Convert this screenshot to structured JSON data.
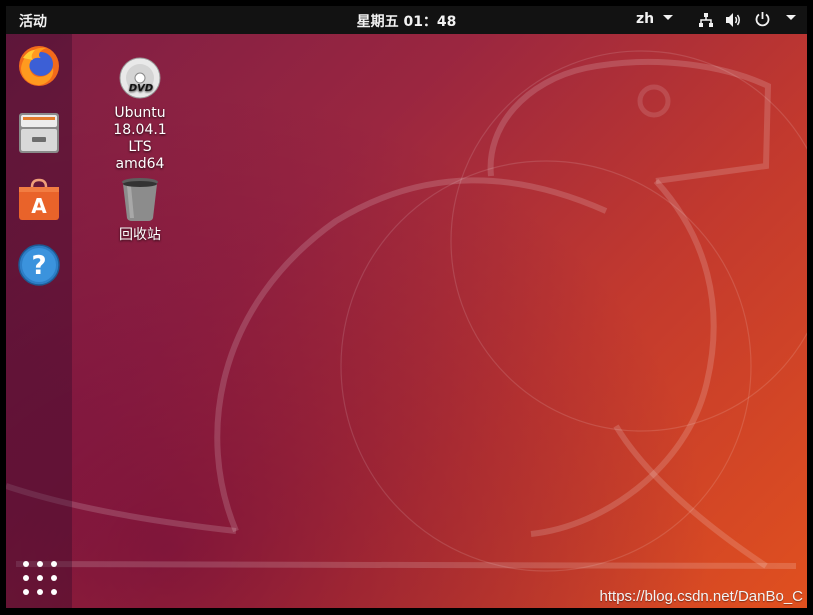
{
  "topbar": {
    "activities": "活动",
    "clock": "星期五 01：48",
    "language": "zh"
  },
  "dock": {
    "items": [
      "firefox-icon",
      "files-icon",
      "software-center-icon",
      "help-icon"
    ],
    "show_apps": "show-applications-icon"
  },
  "desktop": {
    "dvd": {
      "line1": "Ubuntu",
      "line2": "18.04.1 LTS",
      "line3": "amd64"
    },
    "trash": {
      "label": "回收站"
    }
  },
  "watermark": "https://blog.csdn.net/DanBo_C",
  "colors": {
    "topbar": "#121212",
    "wallpaper_start": "#7a1d45",
    "wallpaper_end": "#e0501f"
  }
}
